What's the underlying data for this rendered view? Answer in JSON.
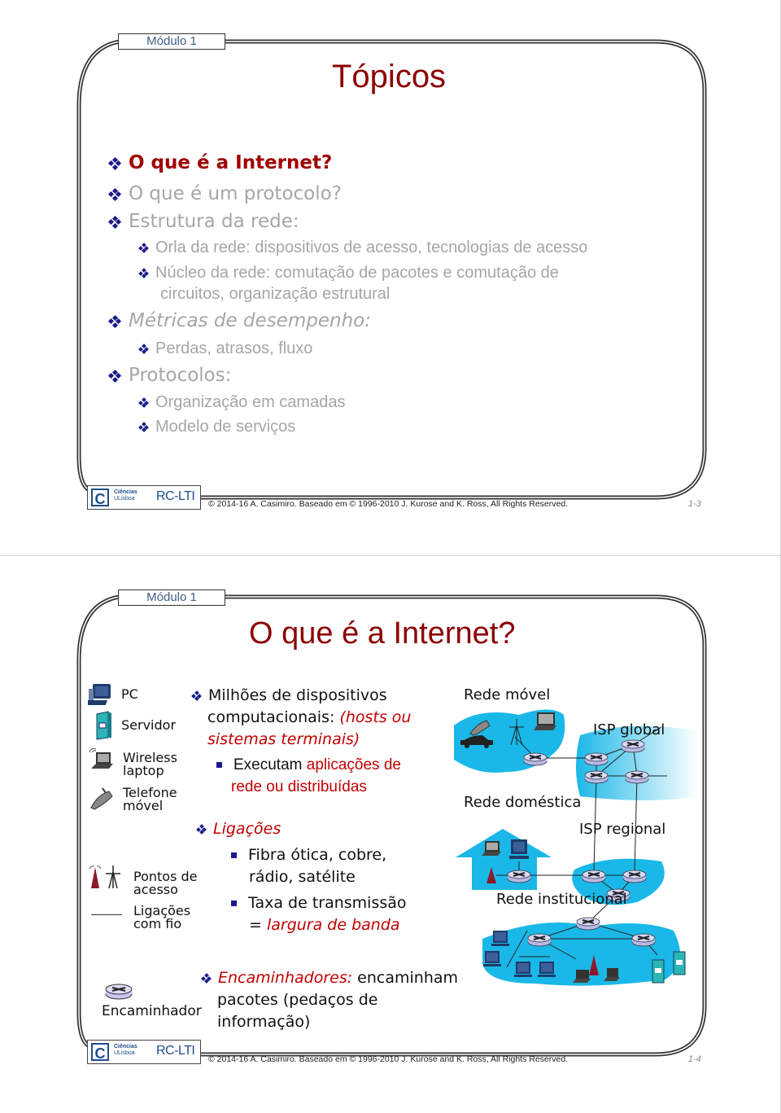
{
  "slides": [
    {
      "module_tag": "Módulo 1",
      "title": "Tópicos",
      "bullets": [
        {
          "level": 1,
          "text": "O que é a Internet?",
          "style": "active"
        },
        {
          "level": 1,
          "text": "O que é um protocolo?",
          "style": "dimmed"
        },
        {
          "level": 1,
          "text": "Estrutura da rede:",
          "style": "dimmed"
        },
        {
          "level": 2,
          "text": "Orla da rede: dispositivos de acesso, tecnologias de acesso",
          "style": "dimmed"
        },
        {
          "level": 2,
          "text": "Núcleo da rede: comutação de pacotes e comutação de",
          "text_cont": "circuitos, organização estrutural",
          "style": "dimmed"
        },
        {
          "level": 1,
          "text": "Métricas de desempenho:",
          "style": "dimmed"
        },
        {
          "level": 2,
          "text": "Perdas, atrasos, fluxo",
          "style": "dimmed"
        },
        {
          "level": 1,
          "text": "Protocolos:",
          "style": "dimmed"
        },
        {
          "level": 2,
          "text": "Organização em camadas",
          "style": "dimmed"
        },
        {
          "level": 2,
          "text": "Modelo de serviços",
          "style": "dimmed"
        }
      ],
      "footer": {
        "logo_letter": "C",
        "logo_line1": "Ciências",
        "logo_line2": "ULisboa",
        "course": "RC-LTI",
        "copyright": "© 2014-16 A. Casimiro. Baseado em © 1996-2010 J. Kurose and K. Ross, All Rights Reserved.",
        "page": "1-3"
      }
    },
    {
      "module_tag": "Módulo 1",
      "title": "O que é a Internet?",
      "legend": [
        {
          "icon": "pc-icon",
          "label": "PC"
        },
        {
          "icon": "server-icon",
          "label": "Servidor"
        },
        {
          "icon": "wireless-laptop-icon",
          "label": "Wireless laptop"
        },
        {
          "icon": "mobile-phone-icon",
          "label": "Telefone móvel"
        },
        {
          "icon": "access-point-icon",
          "label": "Pontos de acesso"
        },
        {
          "icon": "wired-link-icon",
          "label": "Ligações com fio"
        },
        {
          "icon": "router-icon",
          "label": "Encaminhador"
        }
      ],
      "content": {
        "b1_line1": "Milhões de dispositivos",
        "b1_line2_a": "computacionais: ",
        "b1_line2_b": "(hosts ou",
        "b1_line3": "sistemas terminais)",
        "b1_sub_a": "Executam ",
        "b1_sub_b": "aplicações de",
        "b1_sub_c": "rede ou distribuídas",
        "b2_title": "Ligações",
        "b2_sub1_l1": "Fibra ótica, cobre,",
        "b2_sub1_l2": "rádio, satélite",
        "b2_sub2_l1": "Taxa de transmissão",
        "b2_sub2_l2_a": "= ",
        "b2_sub2_l2_b": "largura de banda",
        "b3_title": "Encaminhadores:",
        "b3_l1_rest": " encaminham",
        "b3_l2": "pacotes (pedaços de",
        "b3_l3": "informação)"
      },
      "diagram": {
        "labels": {
          "mobile": "Rede móvel",
          "global_isp": "ISP global",
          "home": "Rede doméstica",
          "regional_isp": "ISP regional",
          "institutional": "Rede institucional"
        },
        "colors": {
          "network_fill": "#1ab8e8",
          "router_fill": "#c8c8f0",
          "ap_red": "#8b1a2a"
        }
      },
      "footer": {
        "logo_letter": "C",
        "logo_line1": "Ciências",
        "logo_line2": "ULisboa",
        "course": "RC-LTI",
        "copyright": "© 2014-16 A. Casimiro. Baseado em © 1996-2010 J. Kurose and K. Ross, All Rights Reserved.",
        "page": "1-4"
      }
    }
  ],
  "colors": {
    "title": "#8b0000",
    "accent_red": "#c00000",
    "dimmed": "#a6a6a6",
    "bullet_blue": "#1a1a8c",
    "module_tag_text": "#3f5f87"
  }
}
